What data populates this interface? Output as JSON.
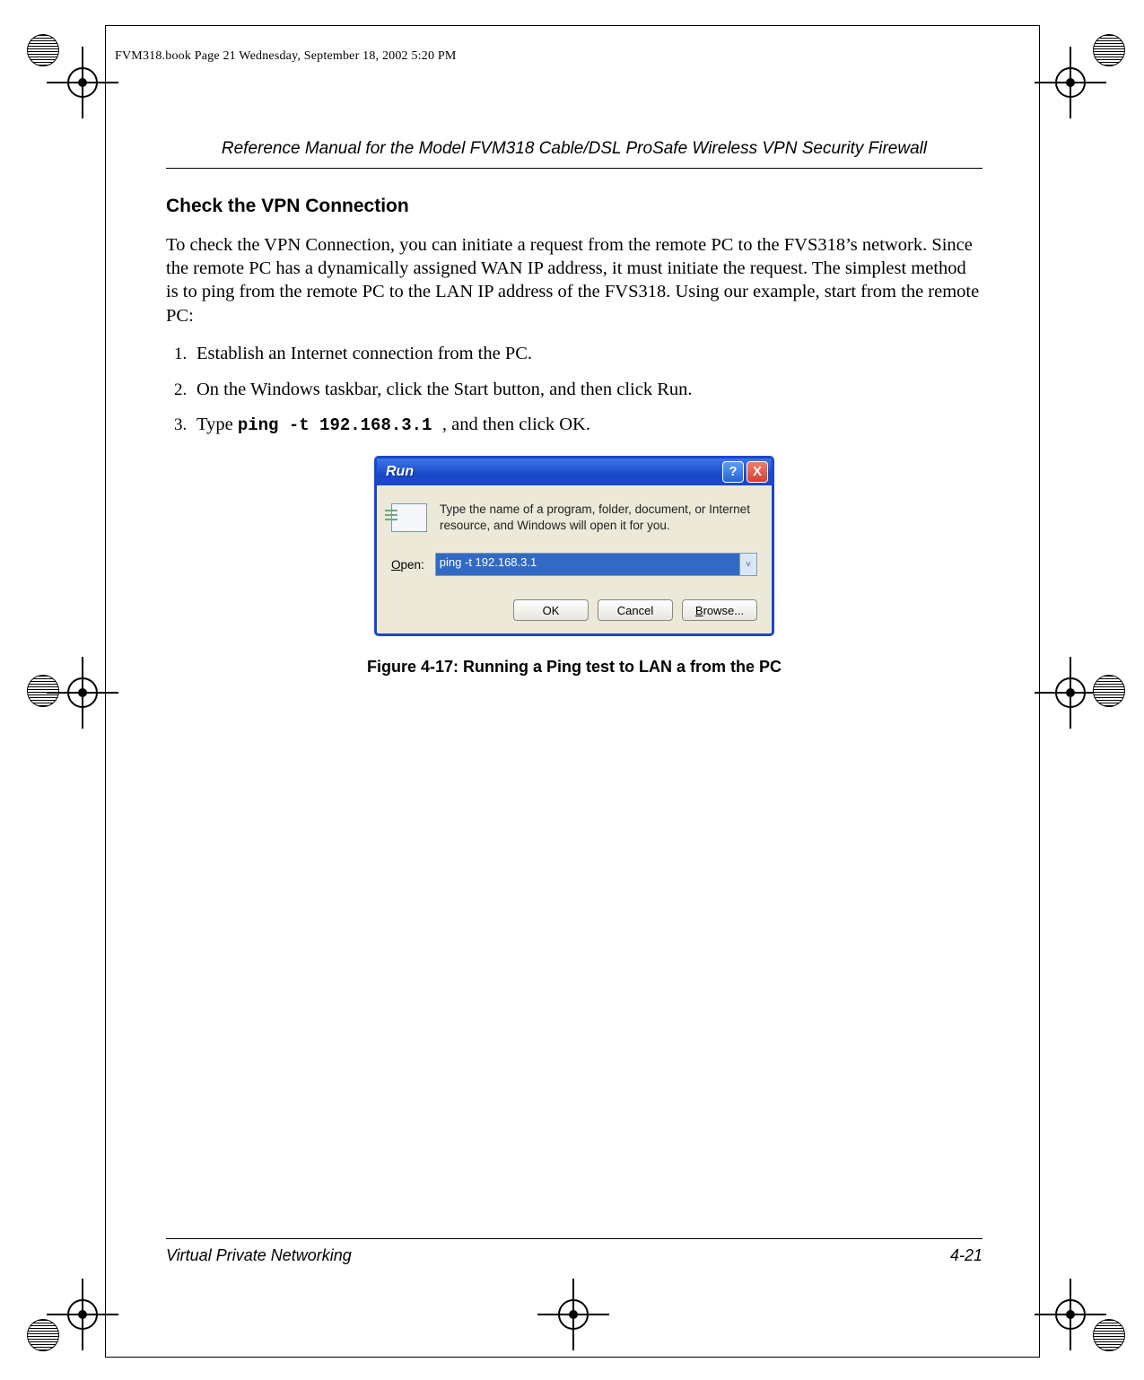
{
  "stamp": "FVM318.book  Page 21  Wednesday, September 18, 2002  5:20 PM",
  "running_head": "Reference Manual for the Model FVM318 Cable/DSL ProSafe Wireless VPN Security Firewall",
  "section_title": "Check the VPN Connection",
  "intro": "To check the VPN Connection, you can initiate a request from the remote PC to the FVS318’s network. Since the remote PC has a dynamically assigned WAN IP address, it must initiate the request. The simplest method is to ping from the remote PC to the LAN IP address of the FVS318. Using our example, start from the remote PC:",
  "steps": {
    "s1": "Establish an Internet connection from the PC.",
    "s2": "On the Windows taskbar, click the Start button, and then click Run.",
    "s3_pre": "Type ",
    "s3_cmd": "ping -t 192.168.3.1 ",
    "s3_post": ", and then click OK."
  },
  "dialog": {
    "title": "Run",
    "help": "?",
    "close": "X",
    "desc": "Type the name of a program, folder, document, or Internet resource, and Windows will open it for you.",
    "open_O": "O",
    "open_rest": "pen:",
    "value": "ping -t 192.168.3.1",
    "arrow": "˅",
    "ok": "OK",
    "cancel": "Cancel",
    "browse_B": "B",
    "browse_rest": "rowse..."
  },
  "figcap": "Figure 4-17:  Running a Ping test to LAN a from the PC",
  "footer": {
    "left": "Virtual Private Networking",
    "right": "4-21"
  }
}
